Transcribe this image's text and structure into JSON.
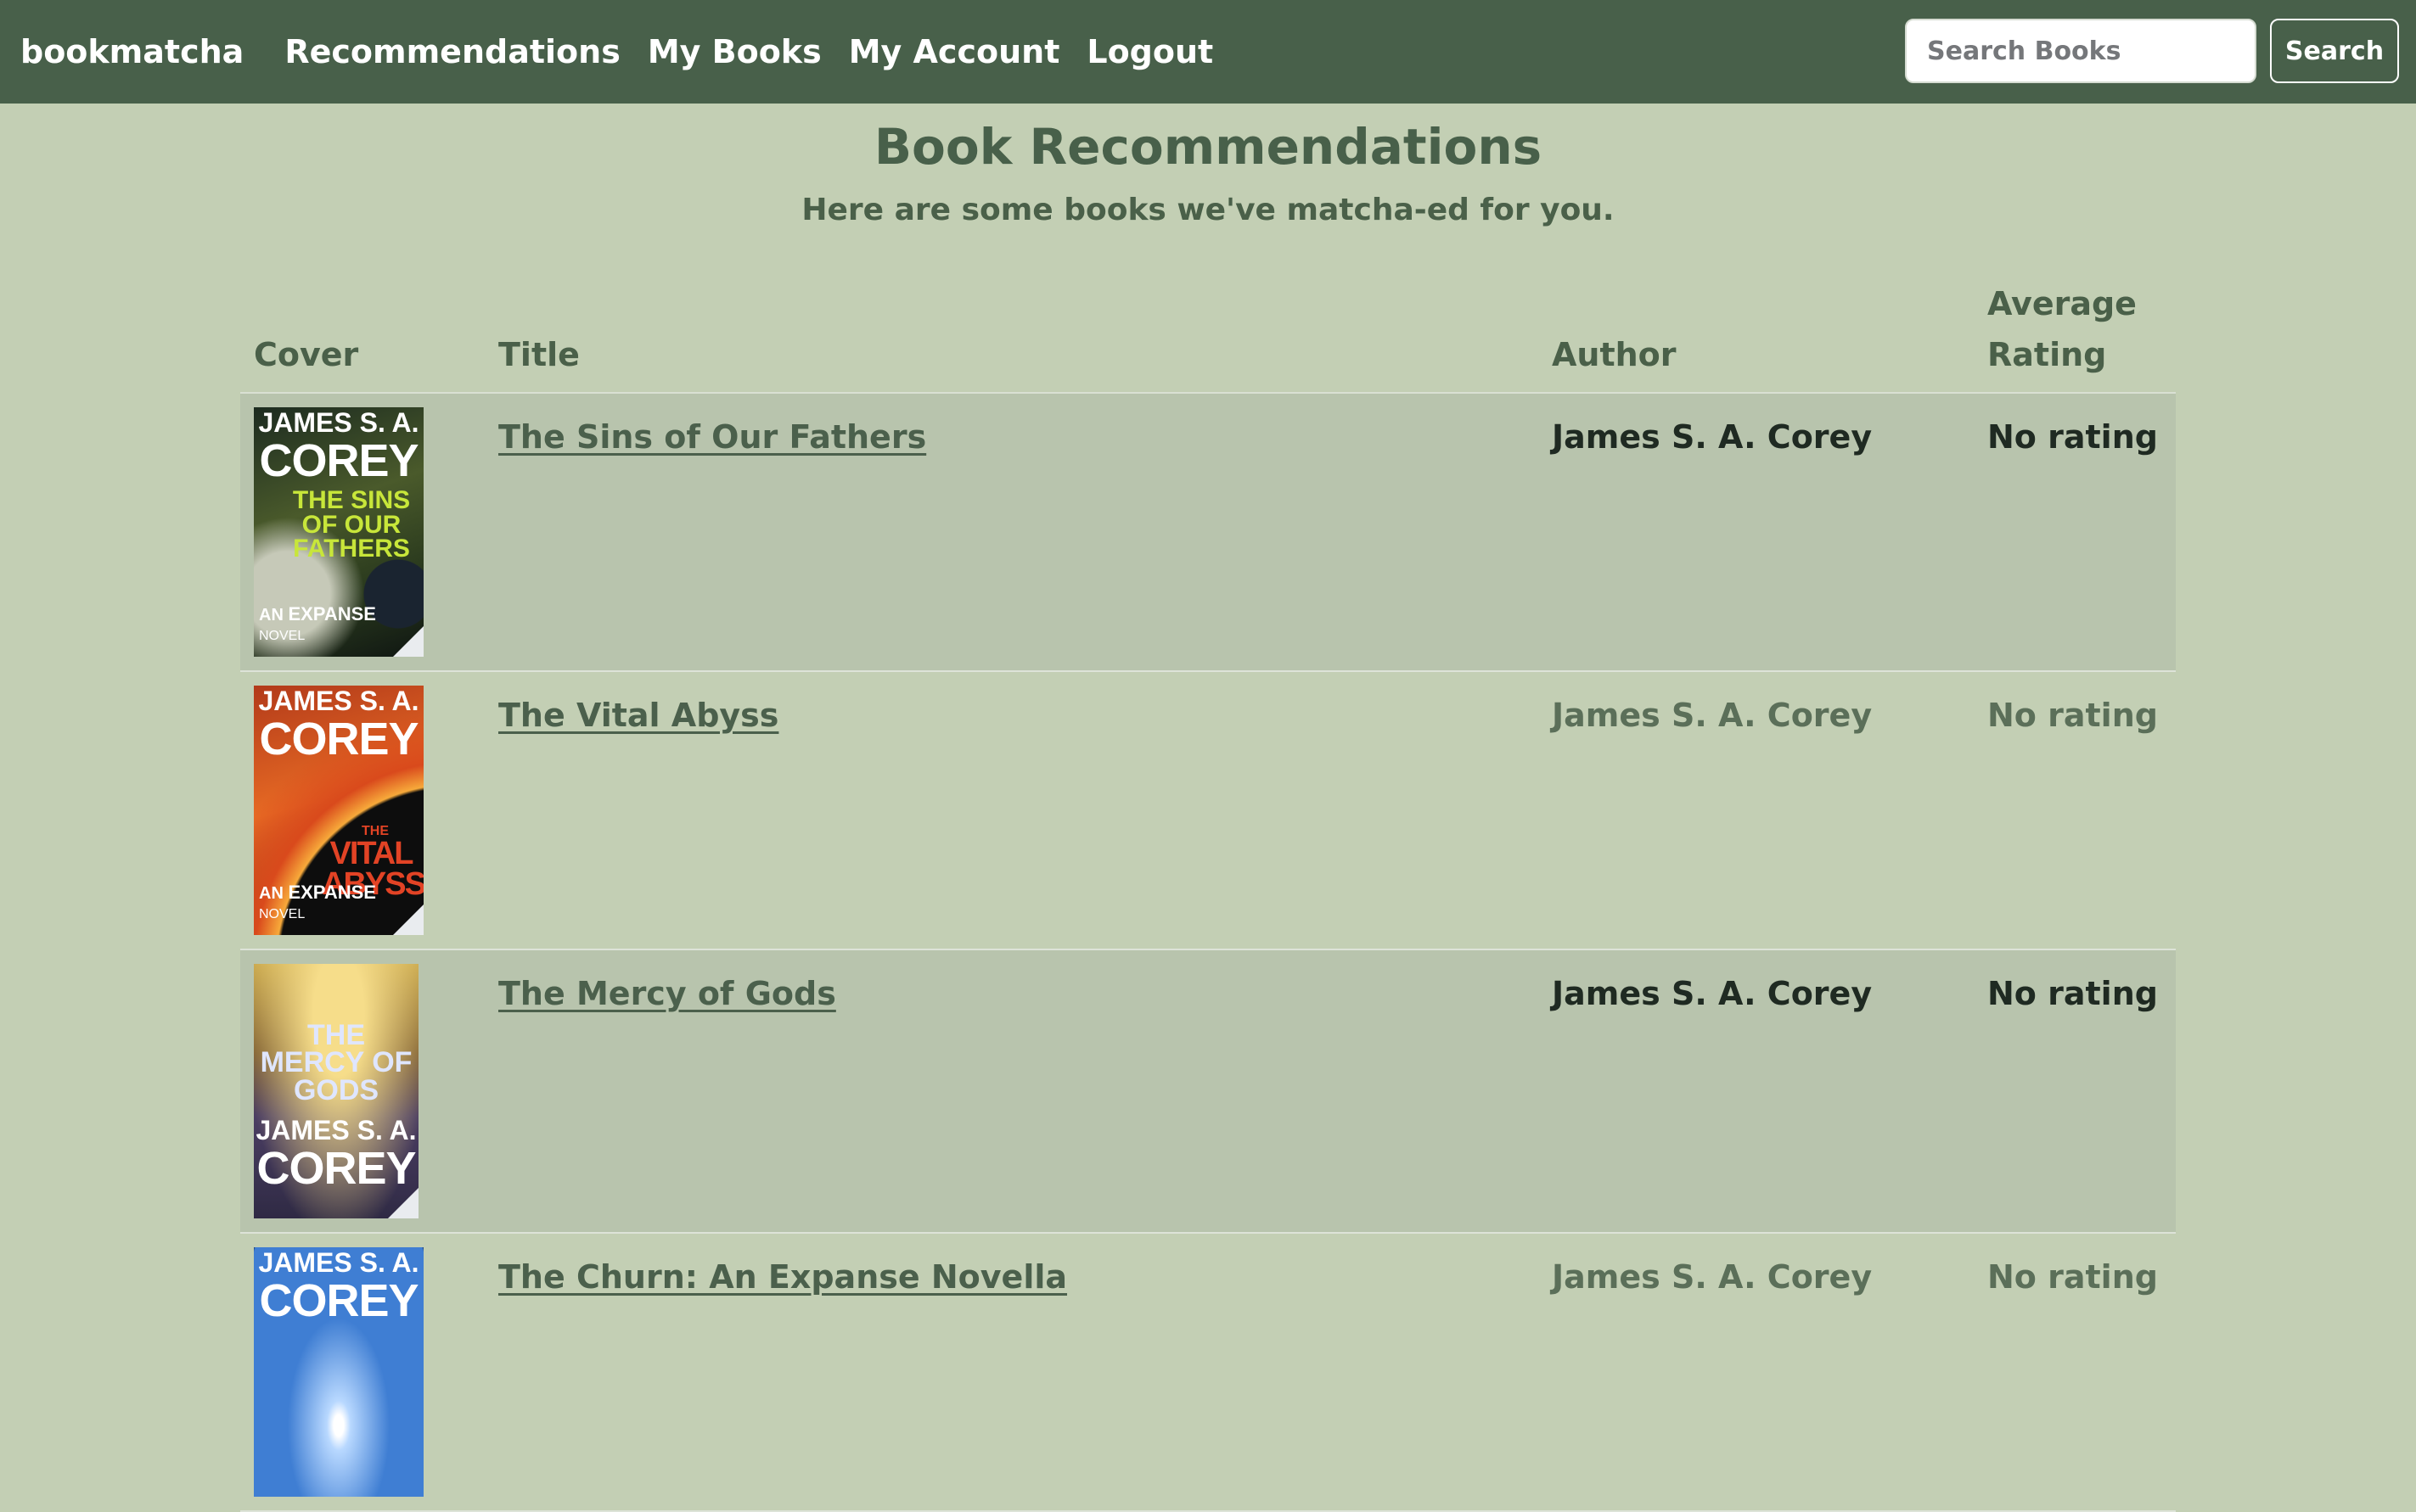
{
  "nav": {
    "brand": "bookmatcha",
    "links": [
      "Recommendations",
      "My Books",
      "My Account",
      "Logout"
    ],
    "search_placeholder": "Search Books",
    "search_button": "Search"
  },
  "page": {
    "title": "Book Recommendations",
    "subtitle": "Here are some books we've matcha-ed for you."
  },
  "table": {
    "headers": {
      "cover": "Cover",
      "title": "Title",
      "author": "Author",
      "rating_line1": "Average",
      "rating_line2": "Rating"
    },
    "rows": [
      {
        "title": "The Sins of Our Fathers",
        "author": "James S. A. Corey",
        "rating": "No rating",
        "cover": {
          "author_small": "JAMES S. A.",
          "author_large": "COREY",
          "book_title": "THE SINS OF OUR FATHERS",
          "series_prefix": "AN",
          "series_name": "EXPANSE",
          "series_suffix": "NOVEL"
        }
      },
      {
        "title": "The Vital Abyss",
        "author": "James S. A. Corey",
        "rating": "No rating",
        "cover": {
          "author_small": "JAMES S. A.",
          "author_large": "COREY",
          "book_title_small": "THE",
          "book_title": "VITAL ABYSS",
          "series_prefix": "AN",
          "series_name": "EXPANSE",
          "series_suffix": "NOVEL"
        }
      },
      {
        "title": "The Mercy of Gods",
        "author": "James S. A. Corey",
        "rating": "No rating",
        "cover": {
          "book_title": "THE MERCY OF GODS",
          "author_small": "JAMES S. A.",
          "author_large": "COREY"
        }
      },
      {
        "title": "The Churn: An Expanse Novella",
        "author": "James S. A. Corey",
        "rating": "No rating",
        "cover": {
          "author_small": "JAMES S. A.",
          "author_large": "COREY"
        }
      }
    ]
  },
  "colors": {
    "navbar": "#48604a",
    "background": "#c3cfb4",
    "stripe": "#b8c4ad",
    "text_green": "#4a6049"
  }
}
